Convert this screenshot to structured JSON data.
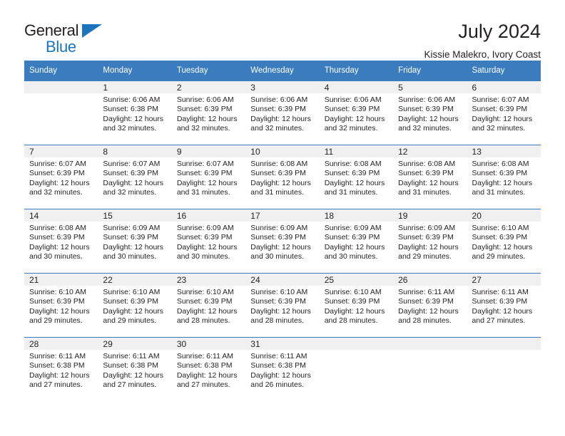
{
  "brand": {
    "name_top": "General",
    "name_bottom": "Blue",
    "triangle_color": "#1b75bb"
  },
  "header": {
    "title": "July 2024",
    "subtitle": "Kissie Malekro, Ivory Coast"
  },
  "theme": {
    "header_blue": "#3a7cbd",
    "daynum_band": "#f0f0f0",
    "text": "#231f20"
  },
  "weekdays": [
    "Sunday",
    "Monday",
    "Tuesday",
    "Wednesday",
    "Thursday",
    "Friday",
    "Saturday"
  ],
  "labels": {
    "sunrise_prefix": "Sunrise:",
    "sunset_prefix": "Sunset:",
    "daylight_prefix": "Daylight:"
  },
  "weeks": [
    [
      {
        "day": "",
        "empty": true
      },
      {
        "day": "1",
        "line1": "Sunrise: 6:06 AM",
        "line2": "Sunset: 6:38 PM",
        "line3": "Daylight: 12 hours",
        "line4": "and 32 minutes."
      },
      {
        "day": "2",
        "line1": "Sunrise: 6:06 AM",
        "line2": "Sunset: 6:39 PM",
        "line3": "Daylight: 12 hours",
        "line4": "and 32 minutes."
      },
      {
        "day": "3",
        "line1": "Sunrise: 6:06 AM",
        "line2": "Sunset: 6:39 PM",
        "line3": "Daylight: 12 hours",
        "line4": "and 32 minutes."
      },
      {
        "day": "4",
        "line1": "Sunrise: 6:06 AM",
        "line2": "Sunset: 6:39 PM",
        "line3": "Daylight: 12 hours",
        "line4": "and 32 minutes."
      },
      {
        "day": "5",
        "line1": "Sunrise: 6:06 AM",
        "line2": "Sunset: 6:39 PM",
        "line3": "Daylight: 12 hours",
        "line4": "and 32 minutes."
      },
      {
        "day": "6",
        "line1": "Sunrise: 6:07 AM",
        "line2": "Sunset: 6:39 PM",
        "line3": "Daylight: 12 hours",
        "line4": "and 32 minutes."
      }
    ],
    [
      {
        "day": "7",
        "line1": "Sunrise: 6:07 AM",
        "line2": "Sunset: 6:39 PM",
        "line3": "Daylight: 12 hours",
        "line4": "and 32 minutes."
      },
      {
        "day": "8",
        "line1": "Sunrise: 6:07 AM",
        "line2": "Sunset: 6:39 PM",
        "line3": "Daylight: 12 hours",
        "line4": "and 32 minutes."
      },
      {
        "day": "9",
        "line1": "Sunrise: 6:07 AM",
        "line2": "Sunset: 6:39 PM",
        "line3": "Daylight: 12 hours",
        "line4": "and 31 minutes."
      },
      {
        "day": "10",
        "line1": "Sunrise: 6:08 AM",
        "line2": "Sunset: 6:39 PM",
        "line3": "Daylight: 12 hours",
        "line4": "and 31 minutes."
      },
      {
        "day": "11",
        "line1": "Sunrise: 6:08 AM",
        "line2": "Sunset: 6:39 PM",
        "line3": "Daylight: 12 hours",
        "line4": "and 31 minutes."
      },
      {
        "day": "12",
        "line1": "Sunrise: 6:08 AM",
        "line2": "Sunset: 6:39 PM",
        "line3": "Daylight: 12 hours",
        "line4": "and 31 minutes."
      },
      {
        "day": "13",
        "line1": "Sunrise: 6:08 AM",
        "line2": "Sunset: 6:39 PM",
        "line3": "Daylight: 12 hours",
        "line4": "and 31 minutes."
      }
    ],
    [
      {
        "day": "14",
        "line1": "Sunrise: 6:08 AM",
        "line2": "Sunset: 6:39 PM",
        "line3": "Daylight: 12 hours",
        "line4": "and 30 minutes."
      },
      {
        "day": "15",
        "line1": "Sunrise: 6:09 AM",
        "line2": "Sunset: 6:39 PM",
        "line3": "Daylight: 12 hours",
        "line4": "and 30 minutes."
      },
      {
        "day": "16",
        "line1": "Sunrise: 6:09 AM",
        "line2": "Sunset: 6:39 PM",
        "line3": "Daylight: 12 hours",
        "line4": "and 30 minutes."
      },
      {
        "day": "17",
        "line1": "Sunrise: 6:09 AM",
        "line2": "Sunset: 6:39 PM",
        "line3": "Daylight: 12 hours",
        "line4": "and 30 minutes."
      },
      {
        "day": "18",
        "line1": "Sunrise: 6:09 AM",
        "line2": "Sunset: 6:39 PM",
        "line3": "Daylight: 12 hours",
        "line4": "and 30 minutes."
      },
      {
        "day": "19",
        "line1": "Sunrise: 6:09 AM",
        "line2": "Sunset: 6:39 PM",
        "line3": "Daylight: 12 hours",
        "line4": "and 29 minutes."
      },
      {
        "day": "20",
        "line1": "Sunrise: 6:10 AM",
        "line2": "Sunset: 6:39 PM",
        "line3": "Daylight: 12 hours",
        "line4": "and 29 minutes."
      }
    ],
    [
      {
        "day": "21",
        "line1": "Sunrise: 6:10 AM",
        "line2": "Sunset: 6:39 PM",
        "line3": "Daylight: 12 hours",
        "line4": "and 29 minutes."
      },
      {
        "day": "22",
        "line1": "Sunrise: 6:10 AM",
        "line2": "Sunset: 6:39 PM",
        "line3": "Daylight: 12 hours",
        "line4": "and 29 minutes."
      },
      {
        "day": "23",
        "line1": "Sunrise: 6:10 AM",
        "line2": "Sunset: 6:39 PM",
        "line3": "Daylight: 12 hours",
        "line4": "and 28 minutes."
      },
      {
        "day": "24",
        "line1": "Sunrise: 6:10 AM",
        "line2": "Sunset: 6:39 PM",
        "line3": "Daylight: 12 hours",
        "line4": "and 28 minutes."
      },
      {
        "day": "25",
        "line1": "Sunrise: 6:10 AM",
        "line2": "Sunset: 6:39 PM",
        "line3": "Daylight: 12 hours",
        "line4": "and 28 minutes."
      },
      {
        "day": "26",
        "line1": "Sunrise: 6:11 AM",
        "line2": "Sunset: 6:39 PM",
        "line3": "Daylight: 12 hours",
        "line4": "and 28 minutes."
      },
      {
        "day": "27",
        "line1": "Sunrise: 6:11 AM",
        "line2": "Sunset: 6:39 PM",
        "line3": "Daylight: 12 hours",
        "line4": "and 27 minutes."
      }
    ],
    [
      {
        "day": "28",
        "line1": "Sunrise: 6:11 AM",
        "line2": "Sunset: 6:38 PM",
        "line3": "Daylight: 12 hours",
        "line4": "and 27 minutes."
      },
      {
        "day": "29",
        "line1": "Sunrise: 6:11 AM",
        "line2": "Sunset: 6:38 PM",
        "line3": "Daylight: 12 hours",
        "line4": "and 27 minutes."
      },
      {
        "day": "30",
        "line1": "Sunrise: 6:11 AM",
        "line2": "Sunset: 6:38 PM",
        "line3": "Daylight: 12 hours",
        "line4": "and 27 minutes."
      },
      {
        "day": "31",
        "line1": "Sunrise: 6:11 AM",
        "line2": "Sunset: 6:38 PM",
        "line3": "Daylight: 12 hours",
        "line4": "and 26 minutes."
      },
      {
        "day": "",
        "empty": true
      },
      {
        "day": "",
        "empty": true
      },
      {
        "day": "",
        "empty": true
      }
    ]
  ]
}
